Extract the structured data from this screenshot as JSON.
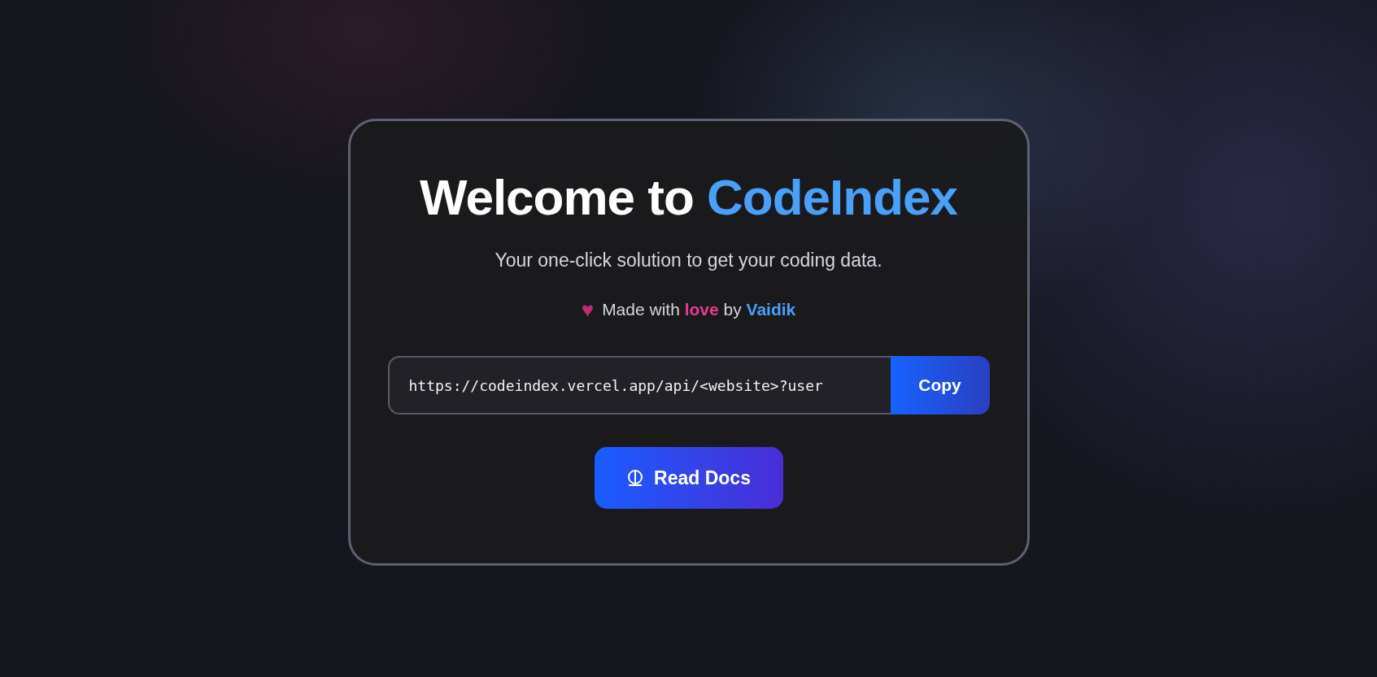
{
  "hero": {
    "title_lead": "Welcome to",
    "title_brand": "CodeIndex",
    "subtitle": "Your one-click solution to get your coding data."
  },
  "credit": {
    "icon": "♥",
    "parts": [
      {
        "text": "Made with",
        "kind": "plain"
      },
      {
        "text": "love",
        "kind": "love"
      },
      {
        "text": "by",
        "kind": "plain"
      },
      {
        "text": "Vaidik",
        "kind": "author"
      }
    ]
  },
  "api_field": {
    "value": "https://codeindex.vercel.app/api/<website>?user",
    "button": "Copy"
  },
  "docs_button": {
    "label": "Read Docs"
  }
}
